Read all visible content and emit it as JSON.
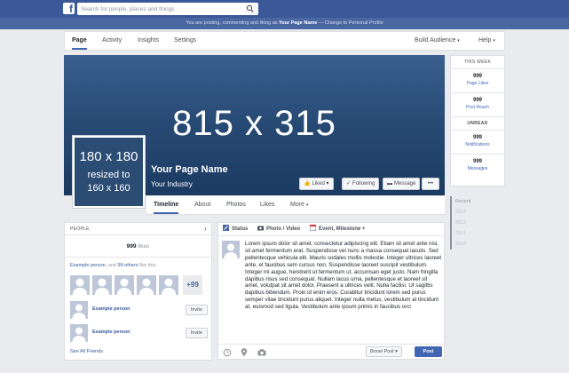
{
  "topbar": {
    "logo_letter": "f",
    "search_placeholder": "Search for people, places and things"
  },
  "notice": {
    "prefix": "You are posting, commenting and liking as ",
    "page_name": "Your Page Name",
    "suffix": " — Change to Personal Profile"
  },
  "page_nav": {
    "items": [
      "Page",
      "Activity",
      "Insights",
      "Settings"
    ],
    "build_audience": "Build Audience",
    "help": "Help"
  },
  "cover": {
    "size_text": "815 x 315"
  },
  "profile_pic": {
    "line1": "180 x 180",
    "line2": "resized to",
    "line3": "160 x 160"
  },
  "page": {
    "name": "Your Page Name",
    "category": "Your Industry"
  },
  "cover_buttons": {
    "liked": "Liked",
    "following": "Following",
    "message": "Message",
    "more": "•••"
  },
  "timeline_nav": {
    "items": [
      "Timeline",
      "About",
      "Photos",
      "Likes",
      "More"
    ]
  },
  "right_panel": {
    "this_week_label": "THIS WEEK",
    "page_likes": {
      "value": "999",
      "label": "Page Likes"
    },
    "post_reach": {
      "value": "999",
      "label": "Post Reach"
    },
    "unread_label": "UNREAD",
    "notifications": {
      "value": "999",
      "label": "Notifications"
    },
    "messages": {
      "value": "999",
      "label": "Messages"
    }
  },
  "recent": {
    "items": [
      "Recent",
      "2013",
      "2012",
      "2011",
      "2010"
    ]
  },
  "people": {
    "header": "PEOPLE",
    "likes_count": "999",
    "likes_word": "likes",
    "friends_name": "Example person",
    "friends_mid": ", and ",
    "friends_others": "99 others",
    "friends_suffix": " like this.",
    "more_count": "+99",
    "suggestions": [
      {
        "name": "Example person",
        "button": "Invite"
      },
      {
        "name": "Example person",
        "button": "Invite"
      }
    ],
    "see_all": "See All Friends"
  },
  "composer": {
    "tabs": [
      "Status",
      "Photo / Video",
      "Event, Milestone +"
    ],
    "text": "Lorem ipsum dolor sit amet, consectetur adipiscing elit. Etiam sit amet ante nisi, sit amet fermentum erat. Suspendisse vel nunc a massa consequat iaculis. Sed pellentesque vehicula elit. Mauris sodales mollis molestie. Integer ultrices laoreet ante, et faucibus sem cursus non. Suspendisse laoreet suscipit vestibulum. Integer mi augue, hendrerit ut fermentum ut, accumsan eget justo. Nam fringilla dapibus risus sed consequat. Nullam lacus urna, pellentesque et laoreet sit amet, volutpat sit amet dolor. Praesent a ultrices velit. Nulla facilisi. Ut sagittis dapibus bibendum. Proin id enim eros. Curabitur tincidunt lorem sed purus semper vitae tincidunt purus aliquet. Integer nulla metus, vestibulum at tincidunt at, euismod sed ligula. Vestibulum ante ipsum primis in faucibus orci",
    "boost_label": "Boost Post",
    "post_label": "Post"
  }
}
